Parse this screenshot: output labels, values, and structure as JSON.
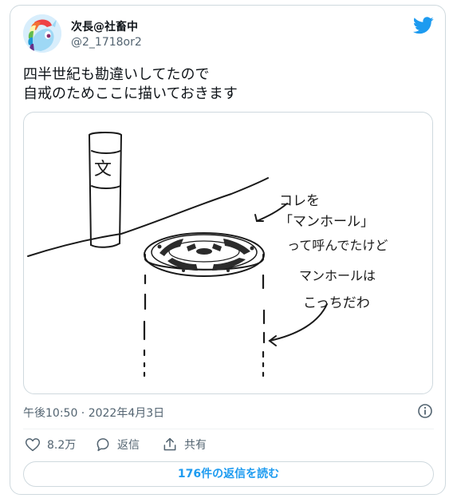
{
  "author": {
    "display_name": "次長@社畜中",
    "handle": "@2_1718or2"
  },
  "tweet": {
    "lines": [
      "四半世紀も勘違いしてたので",
      "自戒のためここに描いておきます"
    ],
    "timestamp": "午後10:50 · 2022年4月3日"
  },
  "illustration": {
    "sign_char": "文",
    "note_lines": [
      "コレを",
      "「マンホール」",
      "って呼んでたけど",
      "マンホールは",
      "こっちだわ"
    ]
  },
  "actions": {
    "likes": "8.2万",
    "reply_label": "返信",
    "share_label": "共有"
  },
  "replies_button": "176件の返信を読む",
  "colors": {
    "accent": "#1d9bf0",
    "muted": "#536471",
    "border": "#cfd9de"
  },
  "icons": [
    "avatar-pony-icon",
    "twitter-bird-icon",
    "info-icon",
    "heart-icon",
    "reply-bubble-icon",
    "share-icon"
  ]
}
